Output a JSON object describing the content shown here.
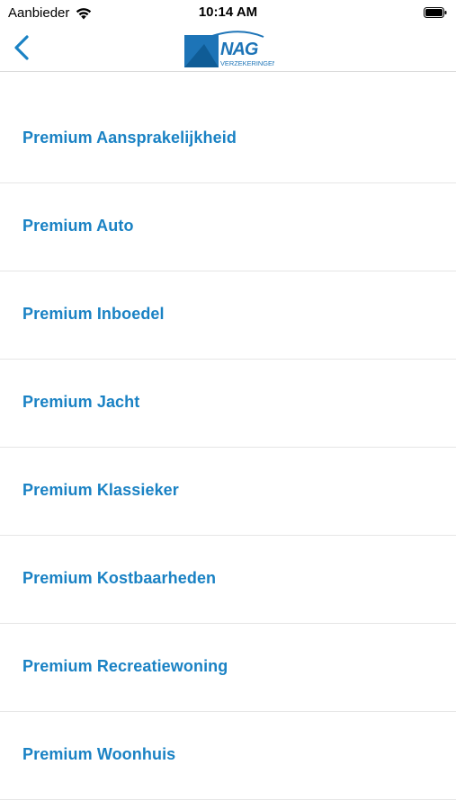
{
  "status_bar": {
    "carrier": "Aanbieder",
    "time": "10:14 AM",
    "icons": [
      "wifi-icon",
      "battery-icon"
    ]
  },
  "nav_bar": {
    "back_icon": "chevron-left-icon",
    "logo": {
      "brand": "NAG",
      "subtitle": "VERZEKERINGEN"
    }
  },
  "colors": {
    "accent": "#1a82c4",
    "logo_blue": "#1d74b7",
    "logo_dark": "#0f5c96",
    "divider": "#e6e6e6"
  },
  "list": {
    "items": [
      {
        "label": "Premium Aansprakelijkheid"
      },
      {
        "label": "Premium Auto"
      },
      {
        "label": "Premium Inboedel"
      },
      {
        "label": "Premium Jacht"
      },
      {
        "label": "Premium Klassieker"
      },
      {
        "label": "Premium Kostbaarheden"
      },
      {
        "label": "Premium Recreatiewoning"
      },
      {
        "label": "Premium Woonhuis"
      }
    ]
  }
}
